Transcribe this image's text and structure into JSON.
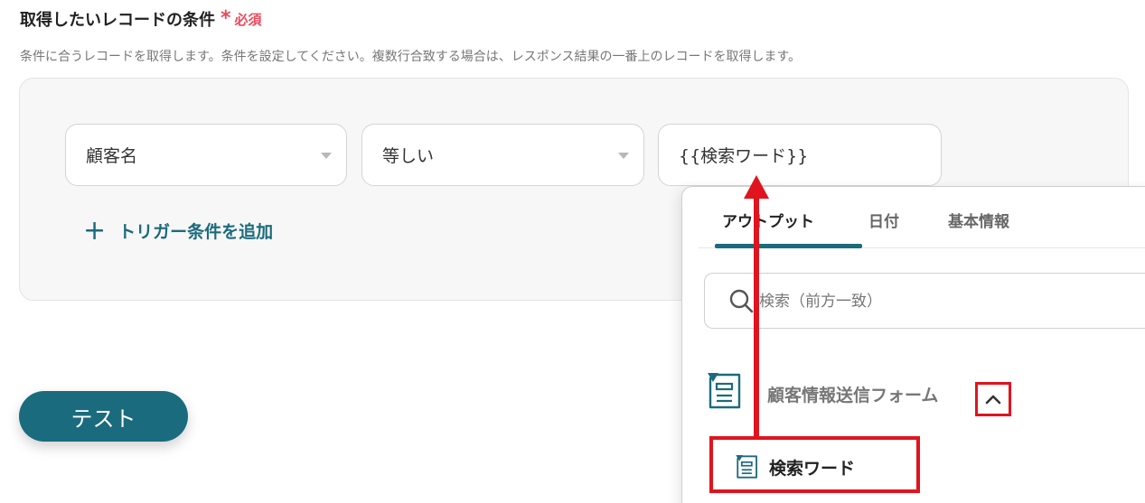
{
  "section": {
    "title": "取得したいレコードの条件",
    "required_mark": "*",
    "required_label": "必須",
    "description": "条件に合うレコードを取得します。条件を設定してください。複数行合致する場合は、レスポンス結果の一番上のレコードを取得します。"
  },
  "condition": {
    "field": "顧客名",
    "operator": "等しい",
    "value": "{{検索ワード}}",
    "add_label": "トリガー条件を追加",
    "add_icon": "+"
  },
  "test_button": "テスト",
  "dropdown": {
    "tabs": [
      {
        "label": "アウトプット",
        "active": true
      },
      {
        "label": "日付",
        "active": false
      },
      {
        "label": "基本情報",
        "active": false
      }
    ],
    "search_placeholder": "検索（前方一致）",
    "group": {
      "label": "顧客情報送信フォーム",
      "icon": "form-icon",
      "expanded": true
    },
    "items": [
      {
        "label": "検索ワード",
        "icon": "form-icon"
      }
    ]
  },
  "colors": {
    "accent": "#1b6b7e",
    "required": "#e94a5b",
    "annotation": "#e0141e"
  }
}
